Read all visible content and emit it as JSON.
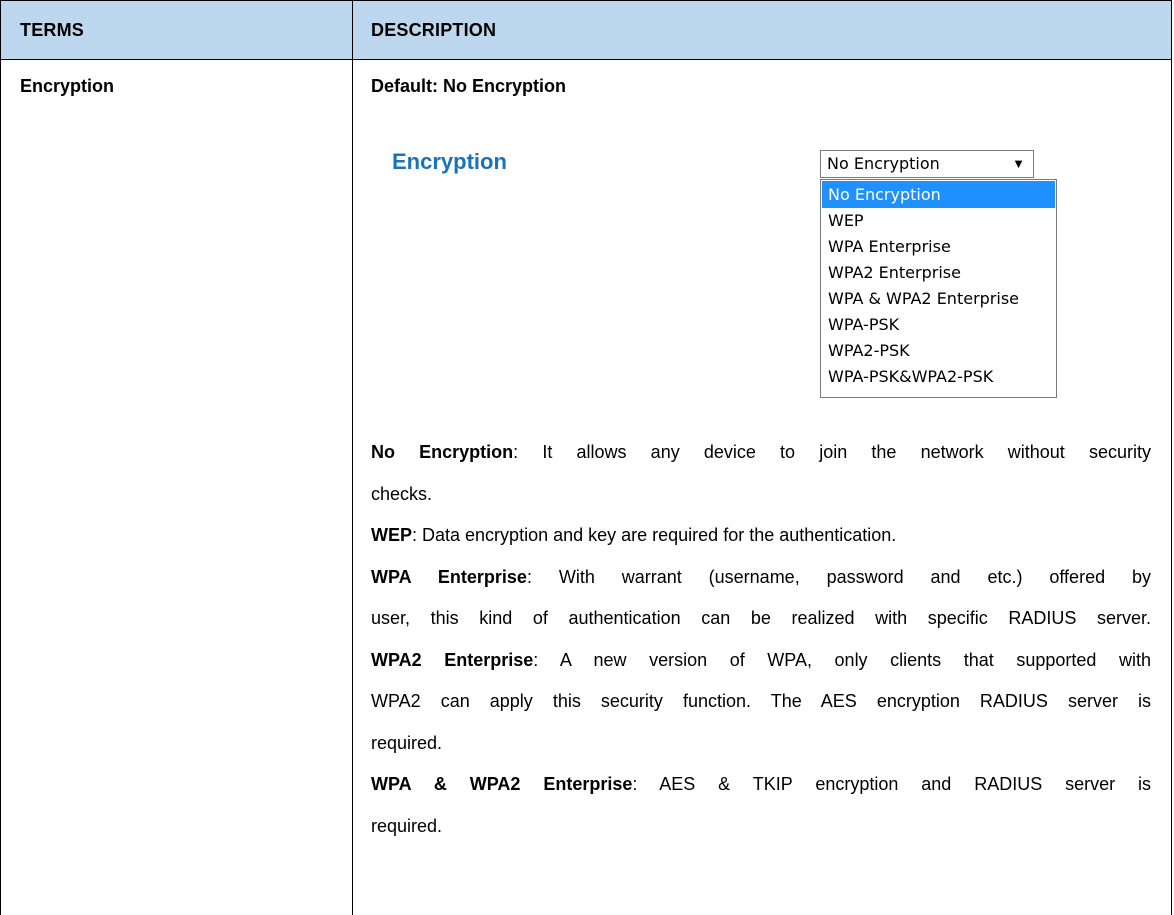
{
  "table": {
    "header": {
      "terms": "TERMS",
      "description": "DESCRIPTION"
    },
    "row": {
      "term": "Encryption",
      "default": "Default: No Encryption"
    }
  },
  "screenshot": {
    "label": "Encryption",
    "select": {
      "value": "No Encryption",
      "arrow": "▼"
    },
    "options": [
      "No Encryption",
      "WEP",
      "WPA Enterprise",
      "WPA2 Enterprise",
      "WPA & WPA2 Enterprise",
      "WPA-PSK",
      "WPA2-PSK",
      "WPA-PSK&WPA2-PSK"
    ],
    "selected_index": 0,
    "colors": {
      "label": "#1a73b8",
      "selected_bg": "#1e90ff",
      "header_bg": "#bdd7ee"
    }
  },
  "descriptions": {
    "no_encryption": {
      "term": "No Encryption",
      "line1": ": It allows any device to join the network without security",
      "line2": "checks."
    },
    "wep": {
      "term": "WEP",
      "text": ": Data encryption and key are required for the authentication."
    },
    "wpa_enterprise": {
      "term": "WPA Enterprise",
      "line1": ": With warrant (username, password and etc.) offered by",
      "line2": "user, this kind of authentication can be realized with specific RADIUS server."
    },
    "wpa2_enterprise": {
      "term": "WPA2 Enterprise",
      "line1": ": A new version of WPA, only clients that supported with",
      "line2": "WPA2 can apply this security function. The AES encryption RADIUS server is",
      "line3": "required."
    },
    "wpa_wpa2_enterprise": {
      "term": "WPA & WPA2 Enterprise",
      "line1": ": AES & TKIP encryption and RADIUS server is",
      "line2": "required."
    }
  }
}
